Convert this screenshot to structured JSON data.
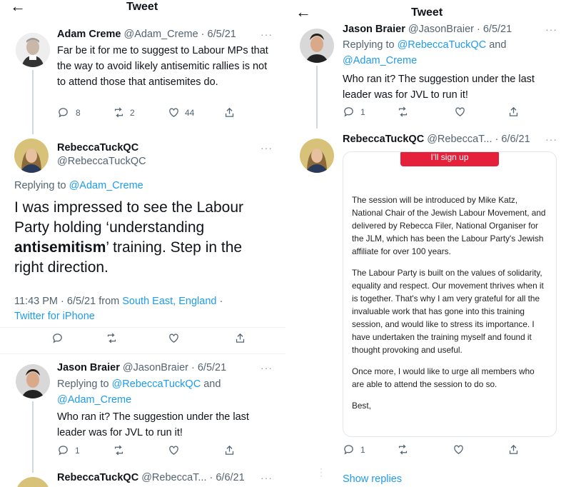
{
  "colors": {
    "link": "#1d9bf0",
    "muted": "#536471",
    "signup_red": "#e4203b"
  },
  "icons": {
    "back": "arrow-left-icon",
    "reply": "reply-icon",
    "retweet": "retweet-icon",
    "like": "heart-icon",
    "share": "share-icon",
    "more": "more-dots-icon"
  },
  "left": {
    "header": {
      "back": "←",
      "title": "Tweet"
    },
    "tweet1": {
      "name": "Adam Creme",
      "handle": "@Adam_Creme · 6/5/21",
      "more": "···",
      "text": "Far be it for me to suggest to Labour MPs that the way to avoid likely antisemitic rallies is not to attend those that antisemites do.",
      "replies": "8",
      "retweets": "2",
      "likes": "44"
    },
    "main": {
      "name": "RebeccaTuckQC",
      "handle": "@RebeccaTuckQC",
      "more": "···",
      "replying_label": "Replying to ",
      "replying_link": "@Adam_Creme",
      "text_1": "I was impressed to see the Labour Party holding ‘understanding ",
      "text_bold": "antisemitism",
      "text_2": "’ training. Step in the right direction.",
      "time": "11:43 PM · 6/5/21 from ",
      "location": "South East, England",
      "dot": " ·",
      "client": "Twitter for iPhone"
    },
    "reply1": {
      "name": "Jason Braier",
      "handle": "@JasonBraier · 6/5/21",
      "more": "···",
      "replying_label": "Replying to ",
      "replying_link_1": "@RebeccaTuckQC",
      "and": " and",
      "replying_link_2": "@Adam_Creme",
      "text": "Who ran it? The suggestion under the last leader was for JVL to run it!",
      "replies": "1"
    },
    "reply2": {
      "name": "RebeccaTuckQC",
      "handle": "@RebeccaT... · 6/6/21",
      "more": "···"
    }
  },
  "right": {
    "header": {
      "back": "←",
      "title": "Tweet"
    },
    "reply1": {
      "name": "Jason Braier",
      "handle": "@JasonBraier · 6/5/21",
      "more": "···",
      "replying_label": "Replying to ",
      "replying_link_1": "@RebeccaTuckQC",
      "and": " and",
      "replying_link_2": "@Adam_Creme",
      "text": "Who ran it? The suggestion under the last leader was for JVL to run it!",
      "replies": "1"
    },
    "reply2": {
      "name": "RebeccaTuckQC",
      "handle": "@RebeccaT... · 6/6/21",
      "more": "···",
      "signup": "I'll sign up",
      "para1": "The session will be introduced by Mike Katz, National Chair of the Jewish Labour Movement, and delivered by Rebecca Filer, National Organiser for the JLM, which has been the Labour Party's Jewish affiliate for over 100 years.",
      "para2": "The Labour Party is built on the values of solidarity, equality and respect. Our movement thrives when it is together. That's why I am very grateful for all the invaluable work that has gone into this training session, and would like to stress its importance. I have undertaken the training myself and found it thought provoking and useful.",
      "para3": "Once more, I would like to urge all members who are able to attend the session to do so.",
      "para4": "Best,",
      "replies": "1",
      "show_replies": "Show replies"
    }
  }
}
